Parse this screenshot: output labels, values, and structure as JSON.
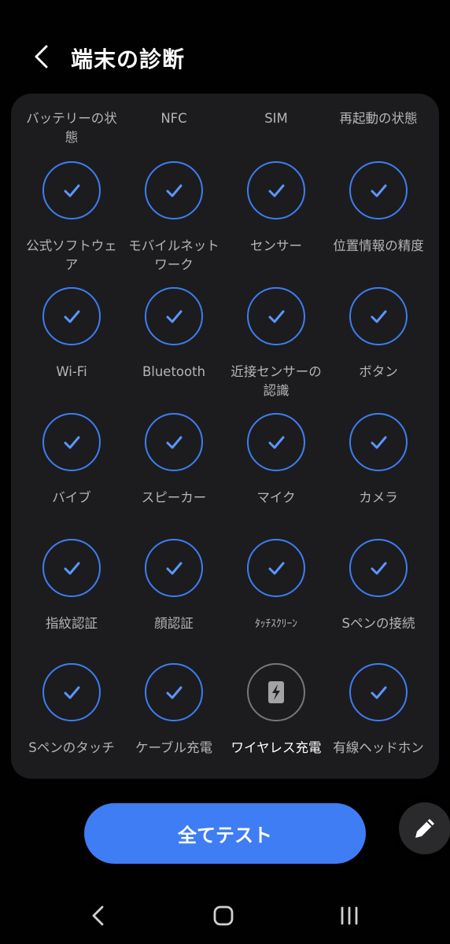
{
  "header": {
    "title": "端末の診断"
  },
  "partial_row": [
    "バッテリーの状態",
    "NFC",
    "SIM",
    "再起動の状態"
  ],
  "rows": [
    [
      {
        "label": "公式ソフトウェア",
        "icon": "check-icon"
      },
      {
        "label": "モバイルネットワーク",
        "icon": "check-icon"
      },
      {
        "label": "センサー",
        "icon": "check-icon"
      },
      {
        "label": "位置情報の精度",
        "icon": "check-icon"
      }
    ],
    [
      {
        "label": "Wi-Fi",
        "icon": "check-icon"
      },
      {
        "label": "Bluetooth",
        "icon": "check-icon"
      },
      {
        "label": "近接センサーの認識",
        "icon": "check-icon"
      },
      {
        "label": "ボタン",
        "icon": "check-icon"
      }
    ],
    [
      {
        "label": "バイブ",
        "icon": "check-icon"
      },
      {
        "label": "スピーカー",
        "icon": "check-icon"
      },
      {
        "label": "マイク",
        "icon": "check-icon"
      },
      {
        "label": "カメラ",
        "icon": "check-icon"
      }
    ],
    [
      {
        "label": "指紋認証",
        "icon": "check-icon"
      },
      {
        "label": "顔認証",
        "icon": "check-icon"
      },
      {
        "label": "ﾀｯﾁｽｸﾘｰﾝ",
        "icon": "check-icon"
      },
      {
        "label": "Sペンの接続",
        "icon": "check-icon"
      }
    ],
    [
      {
        "label": "Sペンのタッチ",
        "icon": "check-icon"
      },
      {
        "label": "ケーブル充電",
        "icon": "check-icon"
      },
      {
        "label": "ワイヤレス充電",
        "icon": "wireless-charging-icon"
      },
      {
        "label": "有線ヘッドホン",
        "icon": "check-icon"
      }
    ]
  ],
  "actions": {
    "test_all": "全てテスト"
  },
  "colors": {
    "accent": "#3e7df3",
    "panel": "#1c1c1e",
    "background": "#010101"
  }
}
